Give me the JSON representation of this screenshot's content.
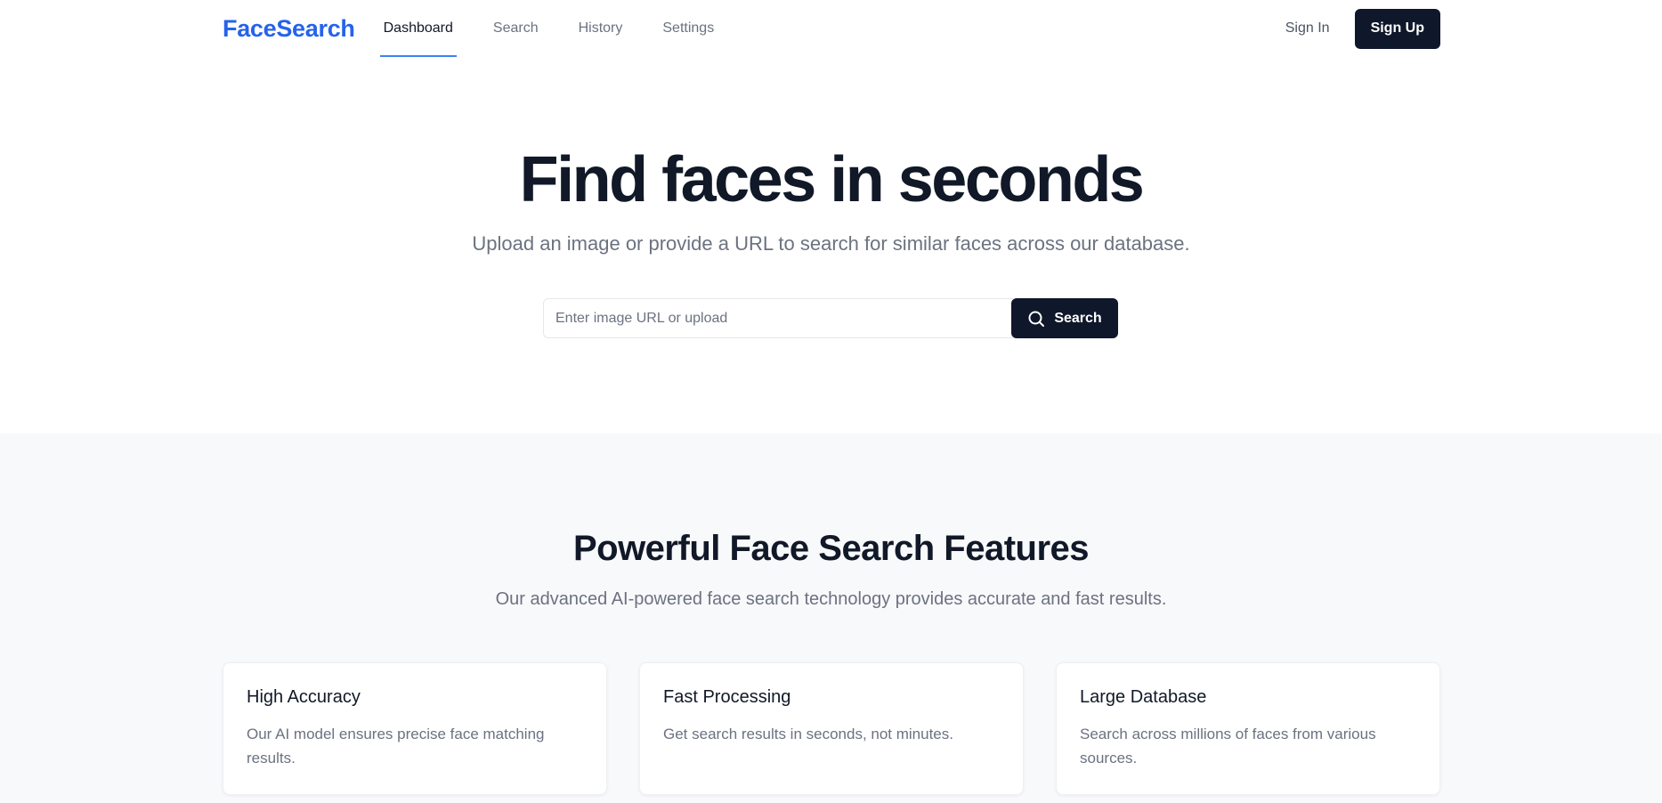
{
  "nav": {
    "logo": "FaceSearch",
    "links": [
      {
        "label": "Dashboard",
        "active": true
      },
      {
        "label": "Search",
        "active": false
      },
      {
        "label": "History",
        "active": false
      },
      {
        "label": "Settings",
        "active": false
      }
    ],
    "sign_in": "Sign In",
    "sign_up": "Sign Up"
  },
  "hero": {
    "title": "Find faces in seconds",
    "subtitle": "Upload an image or provide a URL to search for similar faces across our database.",
    "search_placeholder": "Enter image URL or upload",
    "search_value": "",
    "search_button": "Search",
    "search_icon": "search-icon"
  },
  "features": {
    "title": "Powerful Face Search Features",
    "subtitle": "Our advanced AI-powered face search technology provides accurate and fast results.",
    "cards": [
      {
        "title": "High Accuracy",
        "description": "Our AI model ensures precise face matching results."
      },
      {
        "title": "Fast Processing",
        "description": "Get search results in seconds, not minutes."
      },
      {
        "title": "Large Database",
        "description": "Search across millions of faces from various sources."
      }
    ]
  },
  "colors": {
    "brand": "#2563eb",
    "primary_button": "#0f172a",
    "active_underline": "#3b82f6",
    "muted_text": "#6b7280",
    "section_bg": "#f8f9fb"
  }
}
